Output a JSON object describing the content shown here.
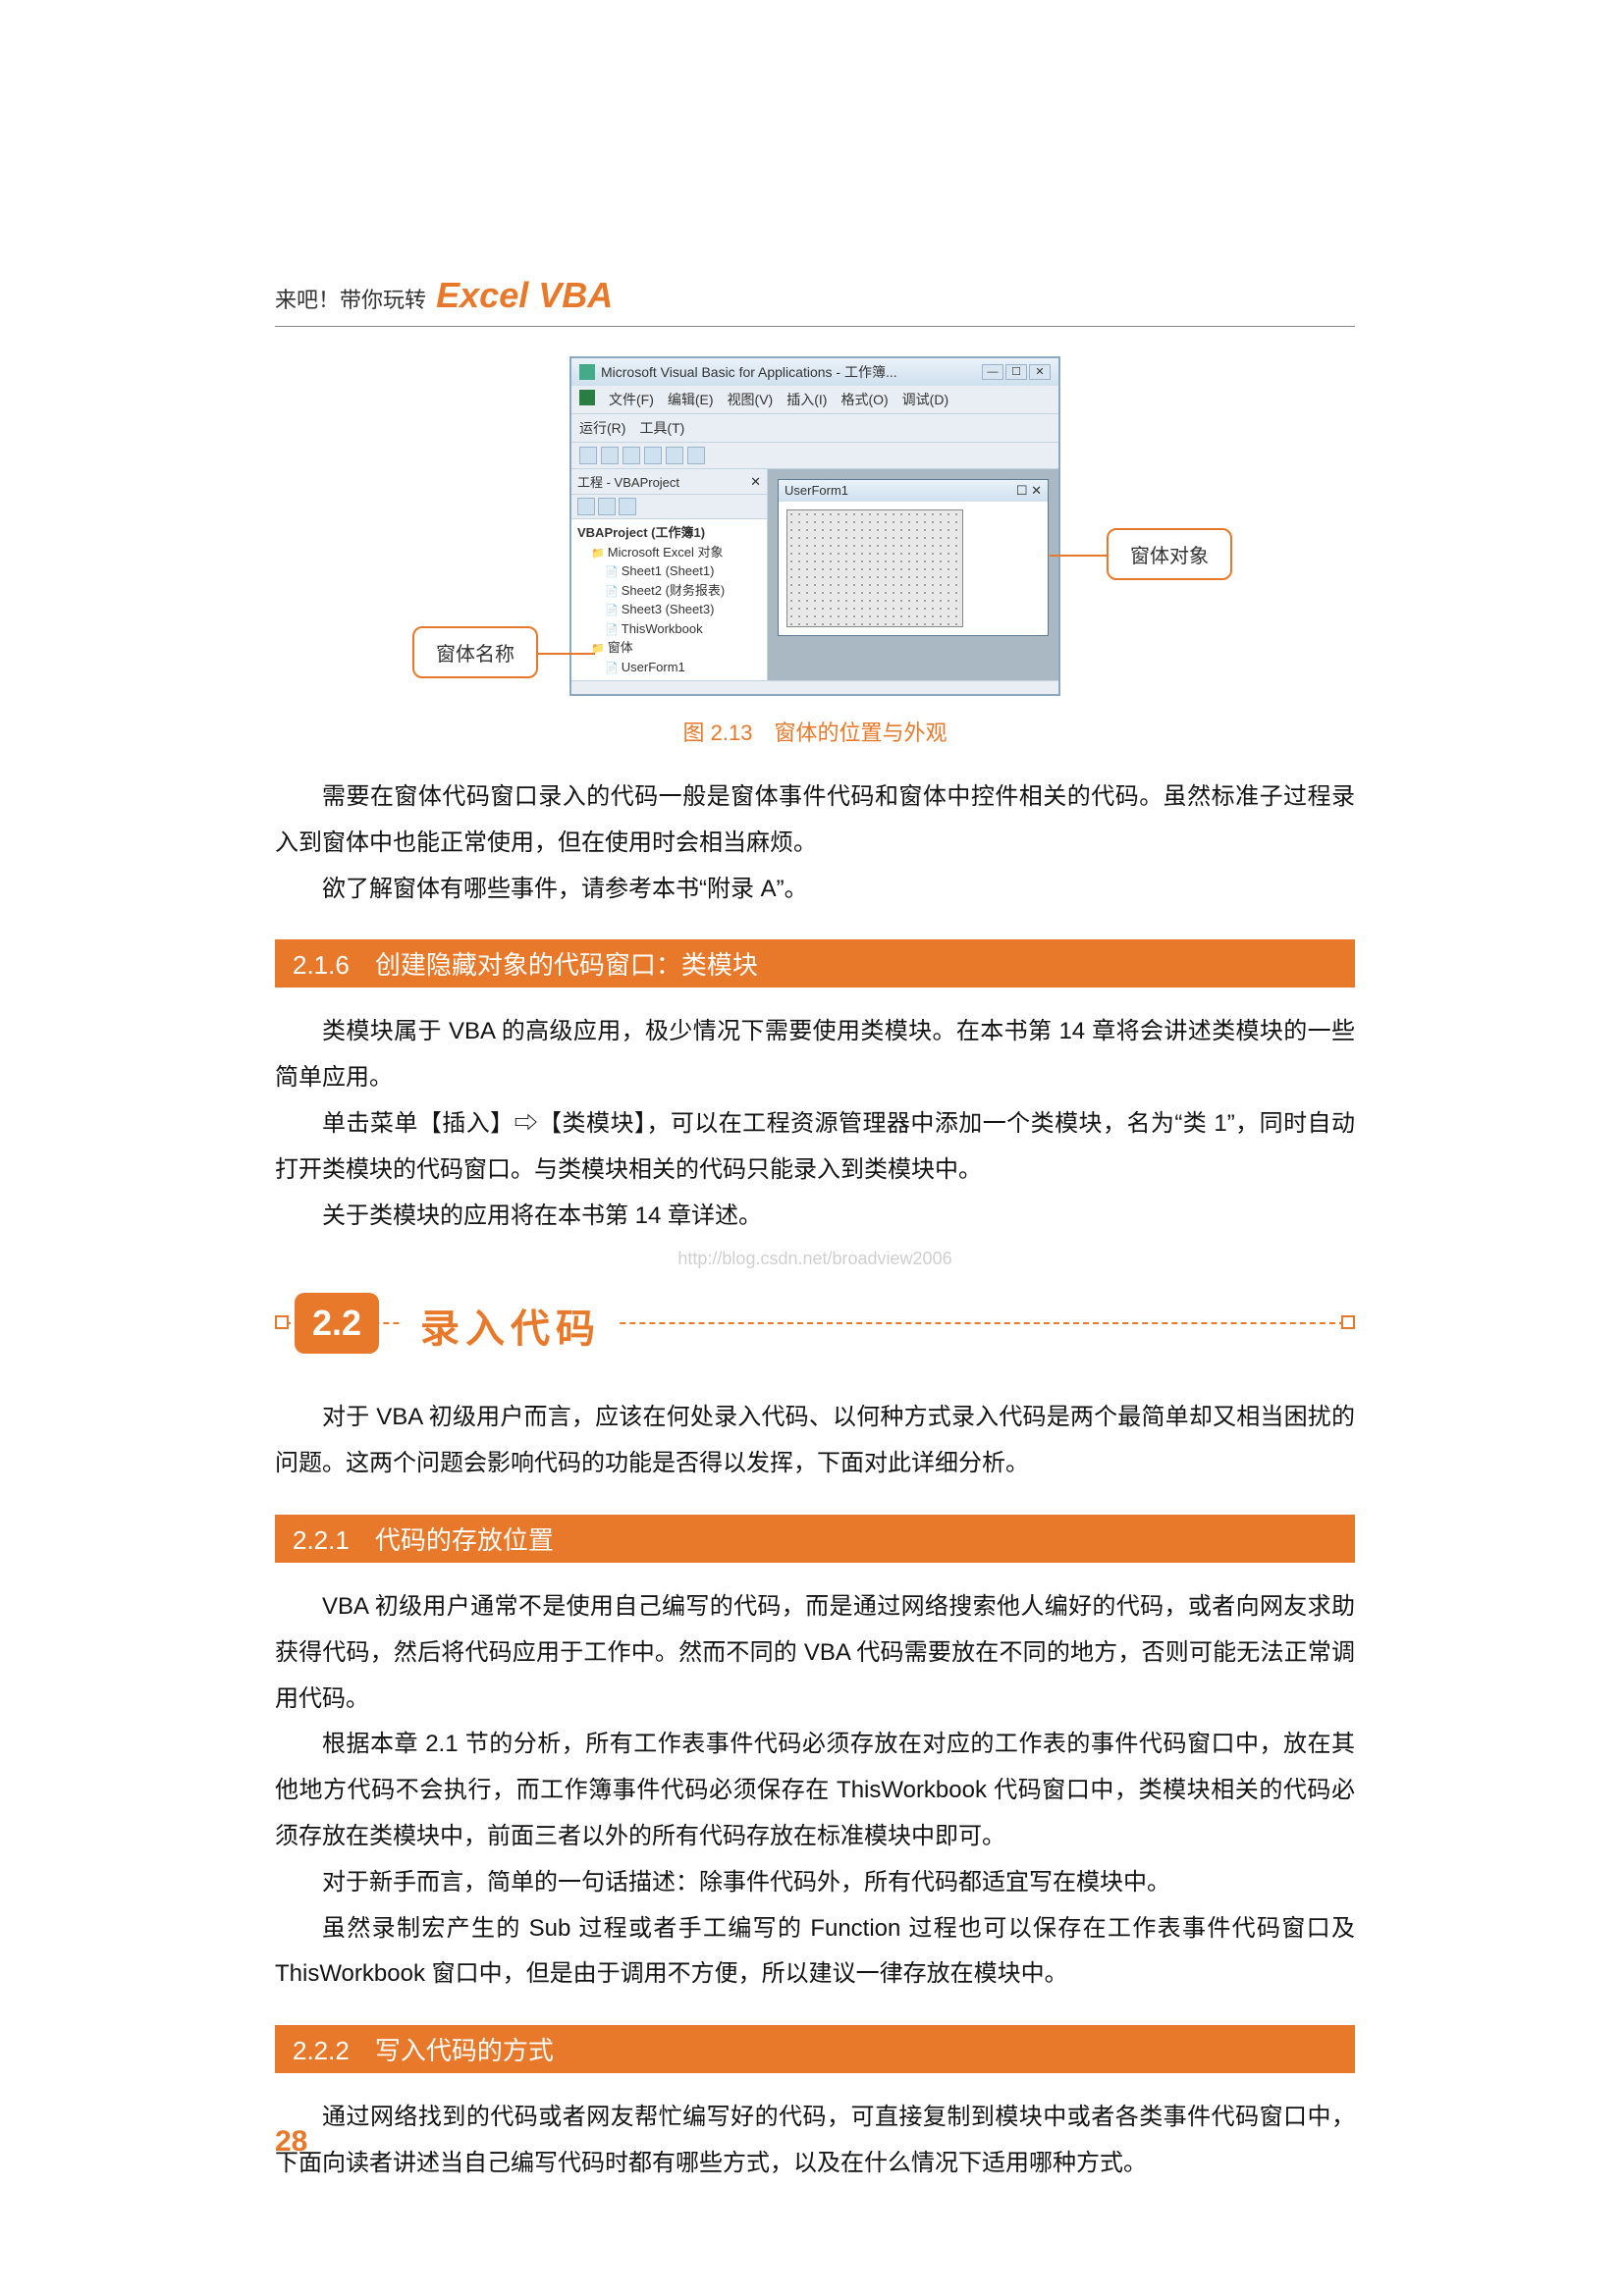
{
  "header": {
    "prefix": "来吧！带你玩转",
    "brand": "Excel VBA"
  },
  "ide": {
    "title": "Microsoft Visual Basic for Applications - 工作簿...",
    "menu1": [
      "文件(F)",
      "编辑(E)",
      "视图(V)",
      "插入(I)",
      "格式(O)",
      "调试(D)"
    ],
    "menu2": [
      "运行(R)",
      "工具(T)"
    ],
    "projectPaneTitle": "工程 - VBAProject",
    "tree": {
      "root": "VBAProject (工作簿1)",
      "msExcelObjects": "Microsoft Excel 对象",
      "sheets": [
        "Sheet1 (Sheet1)",
        "Sheet2 (财务报表)",
        "Sheet3 (Sheet3)",
        "ThisWorkbook"
      ],
      "formsFolder": "窗体",
      "userForm": "UserForm1"
    },
    "formWindowTitle": "UserForm1",
    "callout_left": "窗体名称",
    "callout_right": "窗体对象"
  },
  "figure_caption": "图 2.13　窗体的位置与外观",
  "para_block_1": [
    "需要在窗体代码窗口录入的代码一般是窗体事件代码和窗体中控件相关的代码。虽然标准子过程录入到窗体中也能正常使用，但在使用时会相当麻烦。",
    "欲了解窗体有哪些事件，请参考本书“附录 A”。"
  ],
  "section_216": {
    "num": "2.1.6",
    "title": "创建隐藏对象的代码窗口：类模块"
  },
  "para_block_2": [
    "类模块属于 VBA 的高级应用，极少情况下需要使用类模块。在本书第 14 章将会讲述类模块的一些简单应用。",
    "单击菜单【插入】⇨【类模块】，可以在工程资源管理器中添加一个类模块，名为“类 1”，同时自动打开类模块的代码窗口。与类模块相关的代码只能录入到类模块中。",
    "关于类模块的应用将在本书第 14 章详述。"
  ],
  "watermark": "http://blog.csdn.net/broadview2006",
  "chapter_22": {
    "num": "2.2",
    "title": "录入代码"
  },
  "para_block_3": [
    "对于 VBA 初级用户而言，应该在何处录入代码、以何种方式录入代码是两个最简单却又相当困扰的问题。这两个问题会影响代码的功能是否得以发挥，下面对此详细分析。"
  ],
  "section_221": {
    "num": "2.2.1",
    "title": "代码的存放位置"
  },
  "para_block_4": [
    "VBA 初级用户通常不是使用自己编写的代码，而是通过网络搜索他人编好的代码，或者向网友求助获得代码，然后将代码应用于工作中。然而不同的 VBA 代码需要放在不同的地方，否则可能无法正常调用代码。",
    "根据本章 2.1 节的分析，所有工作表事件代码必须存放在对应的工作表的事件代码窗口中，放在其他地方代码不会执行，而工作簿事件代码必须保存在 ThisWorkbook 代码窗口中，类模块相关的代码必须存放在类模块中，前面三者以外的所有代码存放在标准模块中即可。",
    "对于新手而言，简单的一句话描述：除事件代码外，所有代码都适宜写在模块中。",
    "虽然录制宏产生的 Sub 过程或者手工编写的 Function 过程也可以保存在工作表事件代码窗口及 ThisWorkbook 窗口中，但是由于调用不方便，所以建议一律存放在模块中。"
  ],
  "section_222": {
    "num": "2.2.2",
    "title": "写入代码的方式"
  },
  "para_block_5": [
    "通过网络找到的代码或者网友帮忙编写好的代码，可直接复制到模块中或者各类事件代码窗口中，下面向读者讲述当自己编写代码时都有哪些方式，以及在什么情况下适用哪种方式。"
  ],
  "page_number": "28"
}
